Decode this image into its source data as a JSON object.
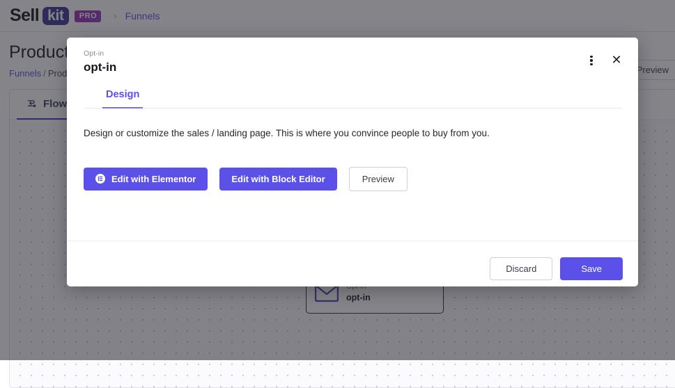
{
  "topbar": {
    "logo_sell": "Sell",
    "logo_kit": "kit",
    "logo_pro": "PRO",
    "separator": "›",
    "funnels_link": "Funnels"
  },
  "page": {
    "title": "Product i",
    "breadcrumb_root": "Funnels",
    "breadcrumb_sep": "/",
    "breadcrumb_current": "Produ",
    "preview_button": "Preview"
  },
  "panel": {
    "tabs": [
      {
        "label": "Flow",
        "icon": "flow-icon",
        "active": true
      }
    ]
  },
  "flow": {
    "add_button": "+",
    "node": {
      "icon": "envelope-icon",
      "subtitle": "Opt-in",
      "title": "opt-in"
    }
  },
  "modal": {
    "eyebrow": "Opt-in",
    "title": "opt-in",
    "kebab_icon": "more-vertical-icon",
    "close_icon": "close-icon",
    "tabs": [
      {
        "label": "Design",
        "active": true
      }
    ],
    "description": "Design or customize the sales / landing page. This is where you convince people to buy from you.",
    "actions": {
      "elementor_label": "Edit with Elementor",
      "elementor_icon": "elementor-icon",
      "block_editor_label": "Edit with Block Editor",
      "preview_label": "Preview"
    },
    "footer": {
      "discard_label": "Discard",
      "save_label": "Save"
    }
  },
  "colors": {
    "accent_purple": "#5b50e8",
    "deep_indigo": "#4a41b8",
    "kit_badge": "#3b3695",
    "pro_badge": "#a32ab0",
    "overlay": "rgba(36,36,44,0.56)"
  }
}
